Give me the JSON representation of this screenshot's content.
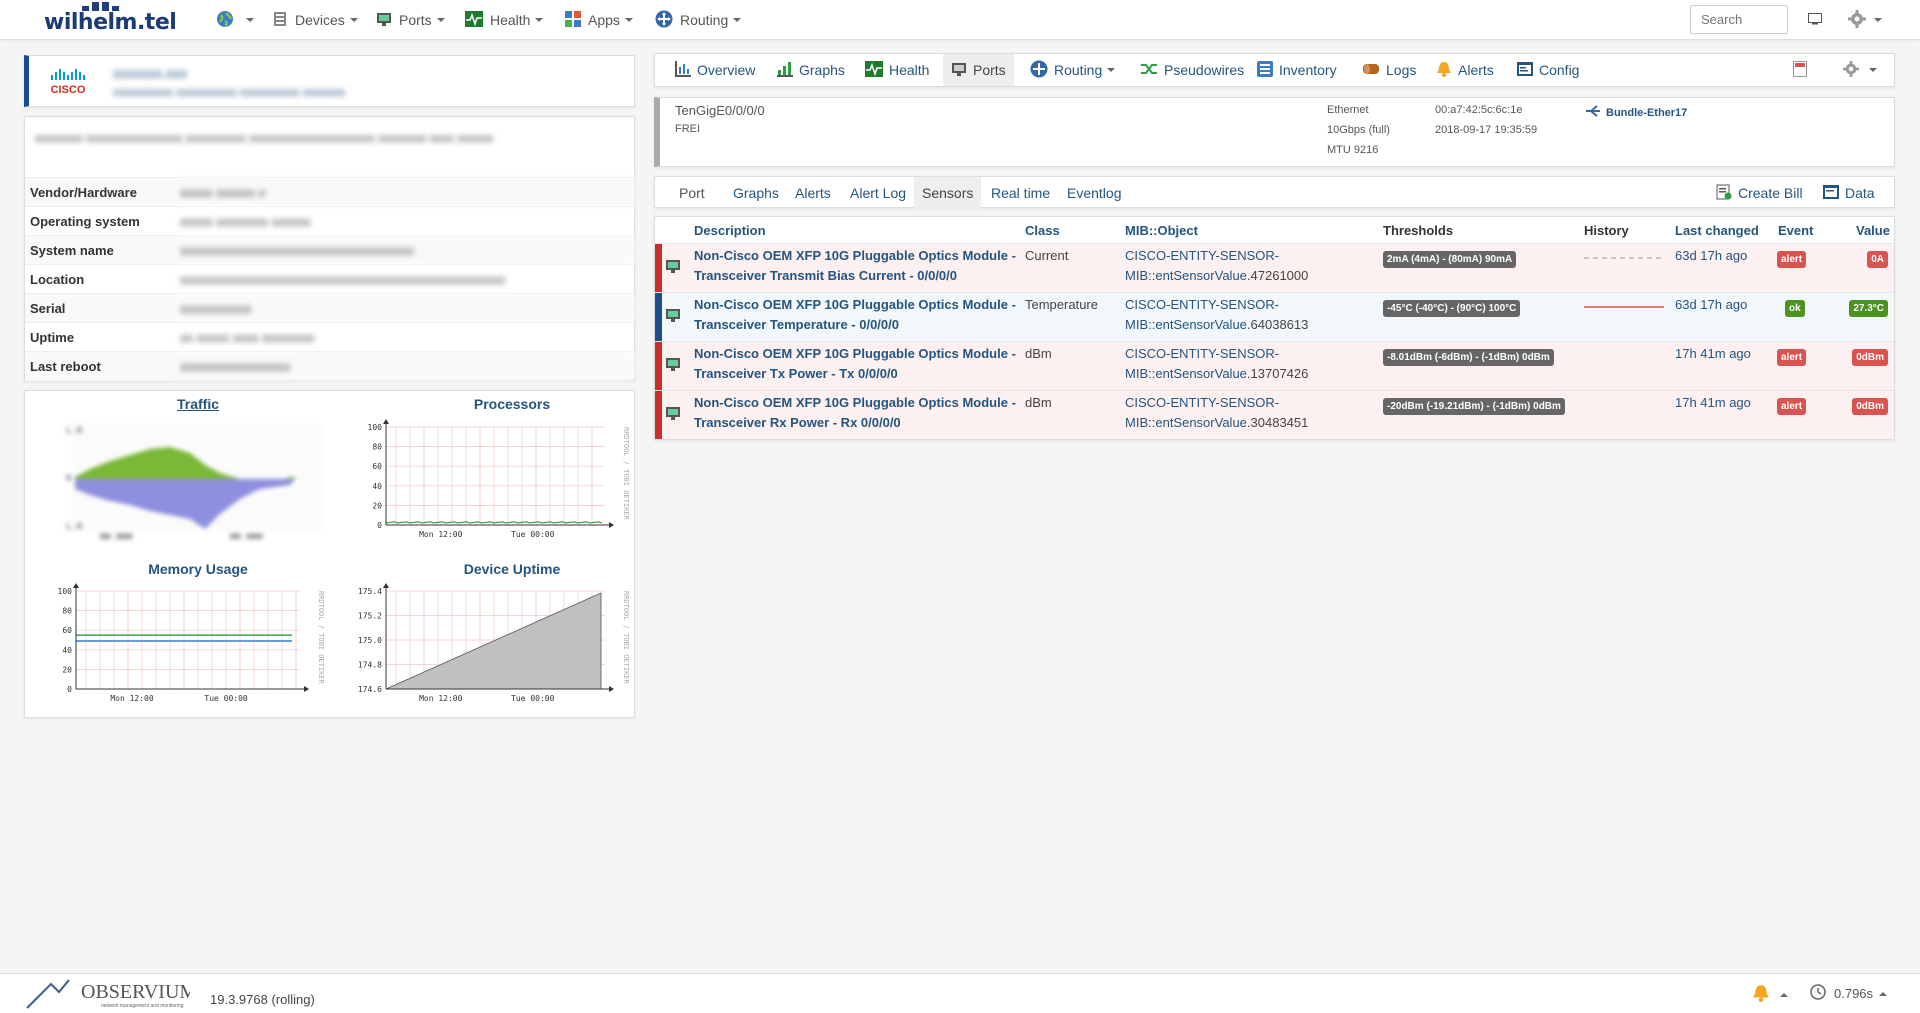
{
  "navbar": {
    "brand": "wilhelm.tel",
    "items": [
      {
        "label": "Devices",
        "icon": "server-icon"
      },
      {
        "label": "Ports",
        "icon": "network-port-icon"
      },
      {
        "label": "Health",
        "icon": "heartbeat-icon"
      },
      {
        "label": "Apps",
        "icon": "apps-grid-icon"
      },
      {
        "label": "Routing",
        "icon": "routing-icon"
      }
    ],
    "search_placeholder": "Search"
  },
  "device": {
    "vendor_logo": "CISCO",
    "hostname": "xxxxxxx.xxx",
    "sysdescr": "xxxxxxxxxx xxxxxxxxxx xxxxxxxxxx xxxxxxx",
    "info_text": "xxxxxxxx xxxxxxxxxxxxxxxx xxxxxxxxxx xxxxxxxxxxxxxxxxxxxxx xxxxxxxx xxxx xxxxxx",
    "info_rows": [
      {
        "label": "Vendor/Hardware",
        "value": "xxxxx xxxxxx x"
      },
      {
        "label": "Operating system",
        "value": "xxxxx xxxxxxxx xxxxxx"
      },
      {
        "label": "System name",
        "value": "xxxxxxxxxxxxxxxxxxxxxxxxxxxxxxxxxxxx"
      },
      {
        "label": "Location",
        "value": "xxxxxxxxxxxxxxxxxxxxxxxxxxxxxxxxxxxxxxxxxxxxxxxxxx"
      },
      {
        "label": "Serial",
        "value": "xxxxxxxxxxx"
      },
      {
        "label": "Uptime",
        "value": "xx xxxxx xxxx xxxxxxxx"
      },
      {
        "label": "Last reboot",
        "value": "xxxxxxxxxxxxxxxxx"
      }
    ]
  },
  "graphs": {
    "traffic": {
      "title": "Traffic"
    },
    "processors": {
      "title": "Processors",
      "yticks": [
        "100",
        "80",
        "60",
        "40",
        "20",
        "0"
      ],
      "xticks": [
        "Mon 12:00",
        "Tue 00:00"
      ],
      "watermark": "RRDTOOL / TOBI OETIKER"
    },
    "memory": {
      "title": "Memory Usage",
      "yticks": [
        "100",
        "80",
        "60",
        "40",
        "20",
        "0"
      ],
      "xticks": [
        "Mon 12:00",
        "Tue 00:00"
      ],
      "watermark": "RRDTOOL / TOBI OETIKER"
    },
    "uptime": {
      "title": "Device Uptime",
      "yticks": [
        "175.4",
        "175.2",
        "175.0",
        "174.8",
        "174.6"
      ],
      "xticks": [
        "Mon 12:00",
        "Tue 00:00"
      ],
      "watermark": "RRDTOOL / TOBI OETIKER"
    }
  },
  "device_tabs": [
    {
      "label": "Overview",
      "icon": "overview-icon"
    },
    {
      "label": "Graphs",
      "icon": "graphs-icon"
    },
    {
      "label": "Health",
      "icon": "heartbeat-icon"
    },
    {
      "label": "Ports",
      "icon": "network-port-icon"
    },
    {
      "label": "Routing",
      "icon": "routing-icon"
    },
    {
      "label": "Pseudowires",
      "icon": "pseudowires-icon"
    },
    {
      "label": "Inventory",
      "icon": "inventory-icon"
    },
    {
      "label": "Logs",
      "icon": "logs-icon"
    },
    {
      "label": "Alerts",
      "icon": "bell-icon"
    },
    {
      "label": "Config",
      "icon": "config-icon"
    }
  ],
  "port": {
    "name": "TenGigE0/0/0/0",
    "descr": "FREI",
    "type": "Ethernet",
    "speed": "10Gbps (full)",
    "mtu": "MTU 9216",
    "mac": "00:a7:42:5c:6c:1e",
    "last_change": "2018-09-17 19:35:59",
    "bundle": "Bundle-Ether17"
  },
  "port_tabs": [
    {
      "label": "Port"
    },
    {
      "label": "Graphs"
    },
    {
      "label": "Alerts"
    },
    {
      "label": "Alert Log"
    },
    {
      "label": "Sensors"
    },
    {
      "label": "Real time"
    },
    {
      "label": "Eventlog"
    }
  ],
  "port_actions": {
    "create_bill": "Create Bill",
    "data": "Data"
  },
  "sensors": {
    "columns": [
      "Description",
      "Class",
      "MIB::Object",
      "Thresholds",
      "History",
      "Last changed",
      "Event",
      "Value"
    ],
    "rows": [
      {
        "desc1": "Non-Cisco OEM XFP 10G Pluggable Optics Module -",
        "desc2": "Transceiver Transmit Bias Current - 0/0/0/0",
        "class": "Current",
        "mib1": "CISCO-ENTITY-SENSOR-",
        "mib2a": "MIB",
        "mib2b": "::",
        "mib2c": "entSensorValue",
        "mib2d": ".47261000",
        "thresholds": "2mA (4mA) - (80mA) 90mA",
        "last_changed": "63d 17h ago",
        "event": "alert",
        "value": "0A",
        "status": "alert"
      },
      {
        "desc1": "Non-Cisco OEM XFP 10G Pluggable Optics Module -",
        "desc2": "Transceiver Temperature - 0/0/0/0",
        "class": "Temperature",
        "mib1": "CISCO-ENTITY-SENSOR-",
        "mib2a": "MIB",
        "mib2b": "::",
        "mib2c": "entSensorValue",
        "mib2d": ".64038613",
        "thresholds": "-45°C (-40°C) - (90°C) 100°C",
        "last_changed": "63d 17h ago",
        "event": "ok",
        "value": "27.3°C",
        "status": "ok"
      },
      {
        "desc1": "Non-Cisco OEM XFP 10G Pluggable Optics Module -",
        "desc2": "Transceiver Tx Power - Tx 0/0/0/0",
        "class": "dBm",
        "mib1": "CISCO-ENTITY-SENSOR-",
        "mib2a": "MIB",
        "mib2b": "::",
        "mib2c": "entSensorValue",
        "mib2d": ".13707426",
        "thresholds": "-8.01dBm (-6dBm) - (-1dBm) 0dBm",
        "last_changed": "17h 41m ago",
        "event": "alert",
        "value": "0dBm",
        "status": "alert"
      },
      {
        "desc1": "Non-Cisco OEM XFP 10G Pluggable Optics Module -",
        "desc2": "Transceiver Rx Power - Rx 0/0/0/0",
        "class": "dBm",
        "mib1": "CISCO-ENTITY-SENSOR-",
        "mib2a": "MIB",
        "mib2b": "::",
        "mib2c": "entSensorValue",
        "mib2d": ".30483451",
        "thresholds": "-20dBm (-19.21dBm) - (-1dBm) 0dBm",
        "last_changed": "17h 41m ago",
        "event": "alert",
        "value": "0dBm",
        "status": "alert"
      }
    ]
  },
  "footer": {
    "logo": "OBSERVIUM",
    "logo_sub": "network management and monitoring",
    "version": "19.3.9768 (rolling)",
    "timing": "0.796s"
  },
  "colors": {
    "accent": "#245580",
    "alert": "#d9534f",
    "ok": "#4d9221",
    "alert_row": "#fdf0f0",
    "ok_row": "#f2f7fb"
  }
}
